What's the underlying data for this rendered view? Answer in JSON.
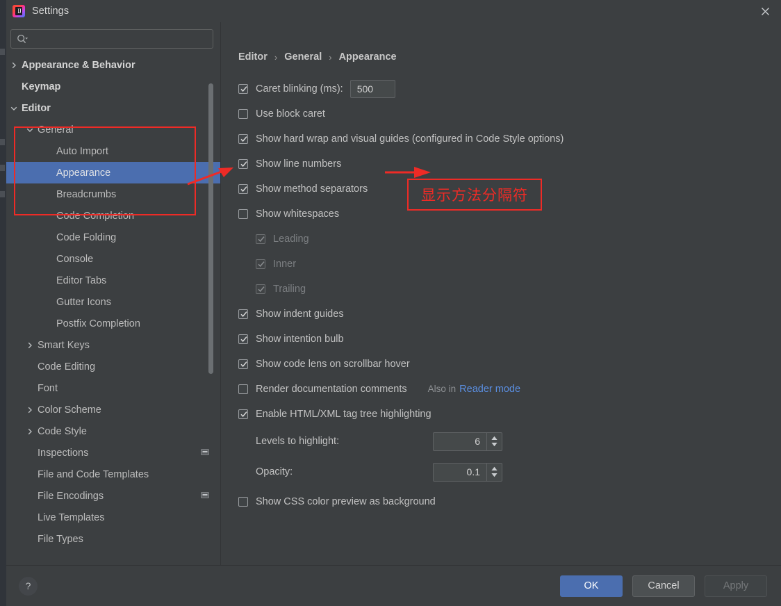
{
  "window": {
    "title": "Settings",
    "logo_icon": "intellij-idea-logo",
    "close_icon": "close-icon"
  },
  "search": {
    "value": "",
    "placeholder": "",
    "icon": "search-icon",
    "dropdown_icon": "chevron-down-icon"
  },
  "sidebar": {
    "items": [
      {
        "label": "Appearance & Behavior",
        "indent": 0,
        "chevron": "chevron-right",
        "bold": true,
        "selected": false,
        "trailing": ""
      },
      {
        "label": "Keymap",
        "indent": 0,
        "chevron": "",
        "bold": true,
        "selected": false,
        "trailing": ""
      },
      {
        "label": "Editor",
        "indent": 0,
        "chevron": "chevron-down",
        "bold": true,
        "selected": false,
        "trailing": ""
      },
      {
        "label": "General",
        "indent": 1,
        "chevron": "chevron-down",
        "bold": false,
        "selected": false,
        "trailing": ""
      },
      {
        "label": "Auto Import",
        "indent": 2,
        "chevron": "",
        "bold": false,
        "selected": false,
        "trailing": ""
      },
      {
        "label": "Appearance",
        "indent": 2,
        "chevron": "",
        "bold": false,
        "selected": true,
        "trailing": ""
      },
      {
        "label": "Breadcrumbs",
        "indent": 2,
        "chevron": "",
        "bold": false,
        "selected": false,
        "trailing": ""
      },
      {
        "label": "Code Completion",
        "indent": 2,
        "chevron": "",
        "bold": false,
        "selected": false,
        "trailing": ""
      },
      {
        "label": "Code Folding",
        "indent": 2,
        "chevron": "",
        "bold": false,
        "selected": false,
        "trailing": ""
      },
      {
        "label": "Console",
        "indent": 2,
        "chevron": "",
        "bold": false,
        "selected": false,
        "trailing": ""
      },
      {
        "label": "Editor Tabs",
        "indent": 2,
        "chevron": "",
        "bold": false,
        "selected": false,
        "trailing": ""
      },
      {
        "label": "Gutter Icons",
        "indent": 2,
        "chevron": "",
        "bold": false,
        "selected": false,
        "trailing": ""
      },
      {
        "label": "Postfix Completion",
        "indent": 2,
        "chevron": "",
        "bold": false,
        "selected": false,
        "trailing": ""
      },
      {
        "label": "Smart Keys",
        "indent": 1,
        "chevron": "chevron-right",
        "bold": false,
        "selected": false,
        "trailing": ""
      },
      {
        "label": "Code Editing",
        "indent": 1,
        "chevron": "",
        "bold": false,
        "selected": false,
        "trailing": ""
      },
      {
        "label": "Font",
        "indent": 1,
        "chevron": "",
        "bold": false,
        "selected": false,
        "trailing": ""
      },
      {
        "label": "Color Scheme",
        "indent": 1,
        "chevron": "chevron-right",
        "bold": false,
        "selected": false,
        "trailing": ""
      },
      {
        "label": "Code Style",
        "indent": 1,
        "chevron": "chevron-right",
        "bold": false,
        "selected": false,
        "trailing": ""
      },
      {
        "label": "Inspections",
        "indent": 1,
        "chevron": "",
        "bold": false,
        "selected": false,
        "trailing": "project-scope-icon"
      },
      {
        "label": "File and Code Templates",
        "indent": 1,
        "chevron": "",
        "bold": false,
        "selected": false,
        "trailing": ""
      },
      {
        "label": "File Encodings",
        "indent": 1,
        "chevron": "",
        "bold": false,
        "selected": false,
        "trailing": "project-scope-icon"
      },
      {
        "label": "Live Templates",
        "indent": 1,
        "chevron": "",
        "bold": false,
        "selected": false,
        "trailing": ""
      },
      {
        "label": "File Types",
        "indent": 1,
        "chevron": "",
        "bold": false,
        "selected": false,
        "trailing": ""
      }
    ]
  },
  "breadcrumb": {
    "parts": [
      "Editor",
      "General",
      "Appearance"
    ],
    "separator": "›"
  },
  "settings": {
    "caret_blinking": {
      "label": "Caret blinking (ms):",
      "checked": true,
      "value": "500"
    },
    "use_block_caret": {
      "label": "Use block caret",
      "checked": false
    },
    "show_hard_wrap": {
      "label": "Show hard wrap and visual guides (configured in Code Style options)",
      "checked": true
    },
    "show_line_numbers": {
      "label": "Show line numbers",
      "checked": true
    },
    "show_method_separators": {
      "label": "Show method separators",
      "checked": true
    },
    "show_whitespaces": {
      "label": "Show whitespaces",
      "checked": false
    },
    "whitespace_leading": {
      "label": "Leading",
      "checked": true,
      "disabled": true
    },
    "whitespace_inner": {
      "label": "Inner",
      "checked": true,
      "disabled": true
    },
    "whitespace_trailing": {
      "label": "Trailing",
      "checked": true,
      "disabled": true
    },
    "show_indent_guides": {
      "label": "Show indent guides",
      "checked": true
    },
    "show_intention_bulb": {
      "label": "Show intention bulb",
      "checked": true
    },
    "show_code_lens": {
      "label": "Show code lens on scrollbar hover",
      "checked": true
    },
    "render_doc_comments": {
      "label": "Render documentation comments",
      "checked": false,
      "hint": "Also in",
      "link": "Reader mode"
    },
    "enable_tag_tree": {
      "label": "Enable HTML/XML tag tree highlighting",
      "checked": true
    },
    "levels_to_highlight": {
      "label": "Levels to highlight:",
      "value": "6"
    },
    "opacity": {
      "label": "Opacity:",
      "value": "0.1"
    },
    "show_css_color_preview": {
      "label": "Show CSS color preview as background",
      "checked": false
    }
  },
  "annotation": {
    "text": "显示方法分隔符",
    "color": "#ee2b26"
  },
  "footer": {
    "help_label": "?",
    "ok": "OK",
    "cancel": "Cancel",
    "apply": "Apply"
  },
  "colors": {
    "dialog_bg": "#3c3f41",
    "selection_blue": "#4b6eaf",
    "link_blue": "#5a8ee0",
    "annotation_red": "#ee2b26"
  }
}
